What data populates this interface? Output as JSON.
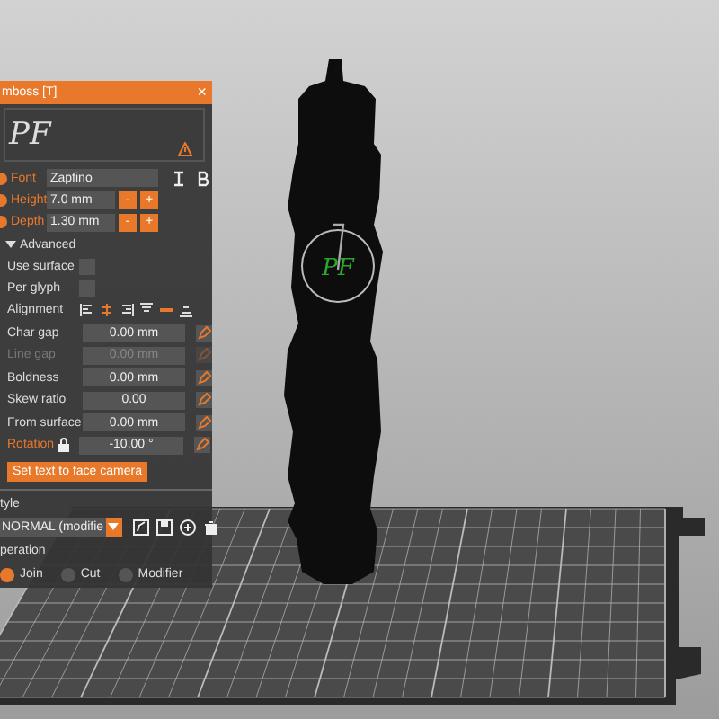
{
  "panel": {
    "title": "mboss [T]",
    "close": "×",
    "preview_text": "PF",
    "warning": true
  },
  "font": {
    "label": "Font",
    "value": "Zapfino",
    "modified": true
  },
  "sizes": [
    {
      "label": "Height",
      "value": "7.0 mm",
      "modified": true,
      "minus": "-",
      "plus": "+"
    },
    {
      "label": "Depth",
      "value": "1.30 mm",
      "modified": true,
      "minus": "-",
      "plus": "+"
    }
  ],
  "advanced": {
    "label": "Advanced",
    "expanded": true
  },
  "checks": [
    {
      "label": "Use surface",
      "checked": false
    },
    {
      "label": "Per glyph",
      "checked": false
    }
  ],
  "alignment": {
    "label": "Alignment",
    "options": [
      {
        "selected": false
      },
      {
        "selected": true
      },
      {
        "selected": false
      },
      {
        "selected": false
      },
      {
        "selected": true
      },
      {
        "selected": false
      }
    ]
  },
  "params": [
    {
      "label": "Char gap",
      "value": "0.00 mm",
      "disabled": false,
      "modified": false,
      "locked": false
    },
    {
      "label": "Line gap",
      "value": "0.00 mm",
      "disabled": true,
      "modified": false,
      "locked": false
    },
    {
      "label": "Boldness",
      "value": "0.00 mm",
      "disabled": false,
      "modified": false,
      "locked": false
    },
    {
      "label": "Skew ratio",
      "value": "0.00",
      "disabled": false,
      "modified": false,
      "locked": false
    },
    {
      "label": "From surface",
      "value": "0.00 mm",
      "disabled": false,
      "modified": false,
      "locked": false
    },
    {
      "label": "Rotation",
      "value": "-10.00 °",
      "disabled": false,
      "modified": true,
      "locked": true
    }
  ],
  "face_camera_button": "Set text to face camera",
  "style": {
    "label": "tyle",
    "value": "NORMAL (modifie"
  },
  "operation": {
    "label": "peration",
    "options": [
      {
        "label": "Join",
        "selected": true
      },
      {
        "label": "Cut",
        "selected": false
      },
      {
        "label": "Modifier",
        "selected": false
      }
    ]
  },
  "viewport": {
    "label": "PF"
  }
}
